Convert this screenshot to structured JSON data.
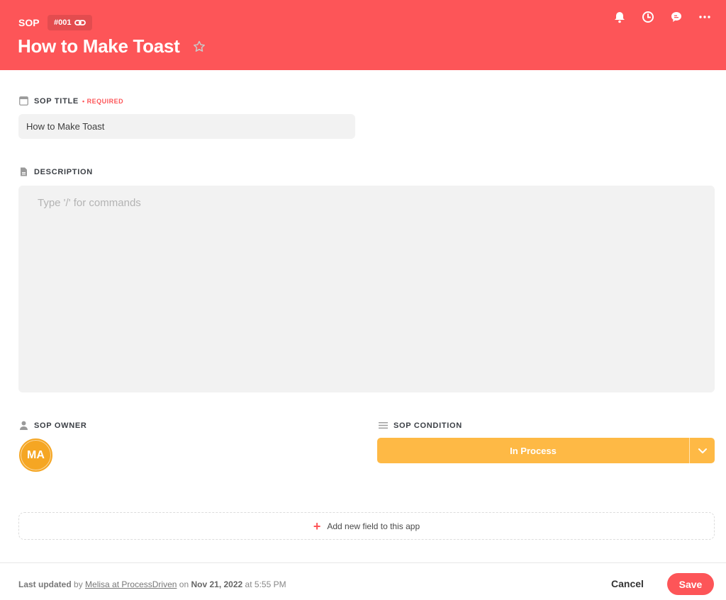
{
  "header": {
    "app_name": "SOP",
    "item_id": "#001",
    "title": "How to Make Toast",
    "actions": [
      {
        "icon": "bell-icon",
        "label": "Notifications"
      },
      {
        "icon": "clock-icon",
        "label": "Activity"
      },
      {
        "icon": "comment-icon",
        "label": "Comments"
      },
      {
        "icon": "more-icon",
        "label": "More"
      }
    ]
  },
  "fields": {
    "title": {
      "label": "SOP TITLE",
      "required_label": "• REQUIRED",
      "value": "How to Make Toast"
    },
    "description": {
      "label": "DESCRIPTION",
      "placeholder": "Type '/' for commands"
    },
    "owner": {
      "label": "SOP OWNER",
      "initials": "MA"
    },
    "condition": {
      "label": "SOP CONDITION",
      "value": "In Process"
    }
  },
  "add_field_label": "Add new field to this app",
  "footer": {
    "last_updated_label": "Last updated",
    "by_label": "by",
    "user": "Melisa at ProcessDriven",
    "on_label": "on",
    "date": "Nov 21, 2022",
    "at_label": "at",
    "time": "5:55 PM",
    "cancel_label": "Cancel",
    "save_label": "Save"
  },
  "colors": {
    "brand": "#fd5558",
    "condition": "#feb945",
    "avatar": "#f5a623"
  }
}
